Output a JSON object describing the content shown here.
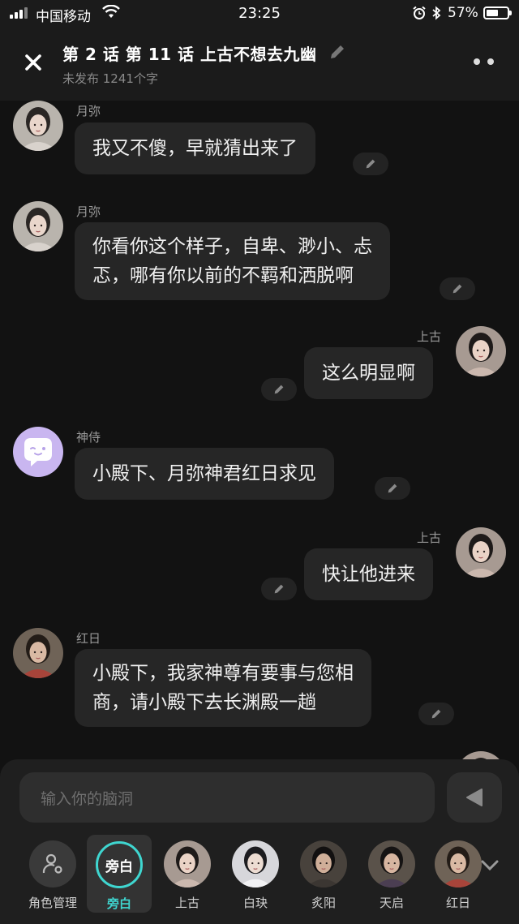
{
  "status_bar": {
    "carrier": "中国移动",
    "time": "23:25",
    "battery": "57%",
    "battery_level": 0.57
  },
  "header": {
    "title": "第 2 话 第 11 话 上古不想去九幽",
    "subtitle": "未发布 1241个字"
  },
  "messages": [
    {
      "side": "left",
      "name": "月弥",
      "avatar": "yuemi",
      "lines": [
        "我又不傻，早就猜出来了"
      ]
    },
    {
      "side": "left",
      "name": "月弥",
      "avatar": "yuemi",
      "lines": [
        "你看你这个样子，自卑、渺小、忐",
        "忑，哪有你以前的不羁和洒脱啊"
      ]
    },
    {
      "side": "right",
      "name": "上古",
      "avatar": "shanggu",
      "lines": [
        "这么明显啊"
      ]
    },
    {
      "side": "left",
      "name": "神侍",
      "avatar": "shenshi",
      "lines": [
        "小殿下、月弥神君红日求见"
      ]
    },
    {
      "side": "right",
      "name": "上古",
      "avatar": "shanggu",
      "lines": [
        "快让他进来"
      ]
    },
    {
      "side": "left",
      "name": "红日",
      "avatar": "hongri",
      "lines": [
        "小殿下，我家神尊有要事与您相",
        "商，请小殿下去长渊殿一趟"
      ]
    }
  ],
  "composer": {
    "placeholder": "输入你的脑洞"
  },
  "roles": [
    {
      "label": "角色管理",
      "kind": "manager"
    },
    {
      "label": "旁白",
      "kind": "narrator",
      "badge": "旁白",
      "active": true
    },
    {
      "label": "上古",
      "kind": "avatar",
      "avatar": "shanggu"
    },
    {
      "label": "白玦",
      "kind": "avatar",
      "avatar": "baijue"
    },
    {
      "label": "炙阳",
      "kind": "avatar",
      "avatar": "zhiyang"
    },
    {
      "label": "天启",
      "kind": "avatar",
      "avatar": "tianqi"
    },
    {
      "label": "红日",
      "kind": "avatar",
      "avatar": "hongri"
    }
  ],
  "colors": {
    "accent": "#3fd6d0",
    "bubble": "#262626",
    "background": "#121212"
  },
  "icons": [
    "close-icon",
    "pencil-icon",
    "more-icon",
    "send-icon",
    "chevron-down-icon",
    "user-settings-icon"
  ]
}
